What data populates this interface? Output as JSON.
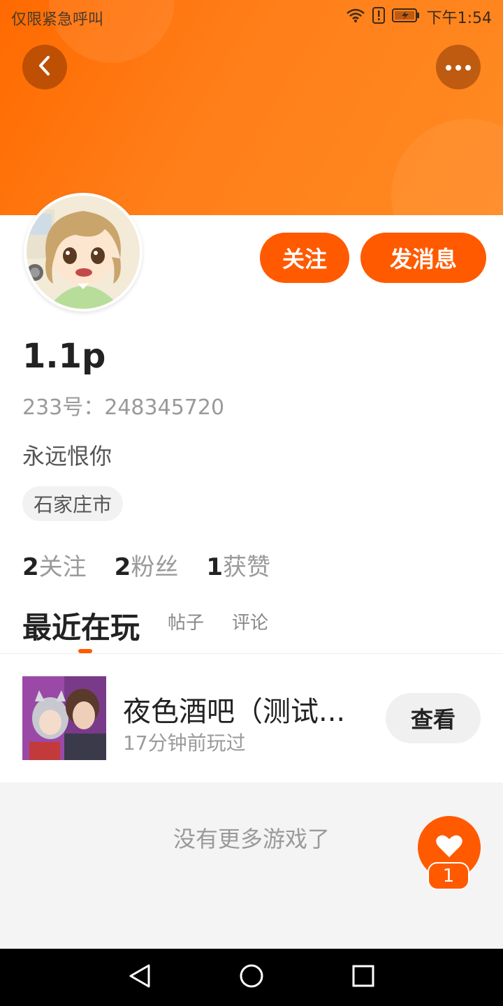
{
  "status_bar": {
    "left_text": "仅限紧急呼叫",
    "time": "下午1:54",
    "icons": [
      "wifi-icon",
      "alert-icon",
      "battery-icon"
    ]
  },
  "header": {
    "back_icon": "chevron-left-icon",
    "more_icon": "more-dots-icon",
    "gradient_colors": [
      "#ff6a00",
      "#ff8a22"
    ]
  },
  "profile": {
    "name": "1.1p",
    "id_line": "233号：248345720",
    "bio": "永远恨你",
    "location": "石家庄市",
    "follow_label": "关注",
    "message_label": "发消息"
  },
  "stats": [
    {
      "num": "2",
      "label": "关注"
    },
    {
      "num": "2",
      "label": "粉丝"
    },
    {
      "num": "1",
      "label": "获赞"
    }
  ],
  "tabs": {
    "active": "最近在玩",
    "posts": "帖子",
    "comments": "评论"
  },
  "recent_game": {
    "title": "夜色酒吧（测试...",
    "time": "17分钟前玩过",
    "button": "查看"
  },
  "footer_text": "没有更多游戏了",
  "like_fab": {
    "icon": "heart-icon",
    "count": "1"
  },
  "nav_bar": {
    "icons": [
      "back-triangle-icon",
      "home-circle-icon",
      "recents-square-icon"
    ]
  },
  "colors": {
    "accent": "#ff5a00",
    "text_primary": "#222222",
    "text_secondary": "#9a9a9a"
  }
}
